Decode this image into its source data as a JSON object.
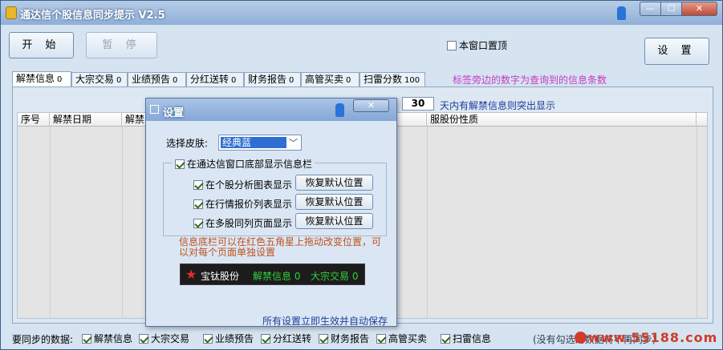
{
  "window": {
    "title": "通达信个股信息同步提示 V2.5",
    "min_glyph": "—",
    "max_glyph": "☐",
    "close_glyph": "✕"
  },
  "toolbar": {
    "start_label": "开 始",
    "pause_label": "暂 停",
    "settings_label": "设 置",
    "topmost_label": "本窗口置顶"
  },
  "tabs": [
    {
      "label": "解禁信息",
      "count": "0"
    },
    {
      "label": "大宗交易",
      "count": "0"
    },
    {
      "label": "业绩预告",
      "count": "0"
    },
    {
      "label": "分红送转",
      "count": "0"
    },
    {
      "label": "财务报告",
      "count": "0"
    },
    {
      "label": "高管买卖",
      "count": "0"
    },
    {
      "label": "扫雷分数",
      "count": "100"
    }
  ],
  "tabs_note": "标签旁边的数字为查询到的信息条数",
  "filter": {
    "days_value": "30",
    "days_label": "天内有解禁信息则突出显示"
  },
  "grid": {
    "columns": [
      "序号",
      "解禁日期",
      "解禁",
      "",
      "",
      "",
      "",
      "",
      "",
      "",
      "",
      "",
      "服股份性质"
    ]
  },
  "bottom": {
    "label": "要同步的数据:",
    "options": [
      "解禁信息",
      "大宗交易",
      "业绩预告",
      "分红送转",
      "财务报告",
      "高管买卖",
      "扫雷信息"
    ],
    "hint": "(没有勾选的数据将不再同步)",
    "watermark": "www.55188.com"
  },
  "dialog": {
    "title": "设置",
    "close_glyph": "✕",
    "skin_label": "选择皮肤:",
    "skin_value": "经典蓝",
    "show_bar_label": "在通达信窗口底部显示信息栏",
    "sub_options": [
      "在个股分析图表显示",
      "在行情报价列表显示",
      "在多股同列页面显示"
    ],
    "reset_label": "恢复默认位置",
    "note": "信息底栏可以在红色五角星上拖动改变位置，可以对每个页面单独设置",
    "preview": {
      "name": "宝钛股份",
      "item1": "解禁信息 0",
      "item2": "大宗交易 0"
    },
    "footer": "所有设置立即生效并自动保存"
  }
}
